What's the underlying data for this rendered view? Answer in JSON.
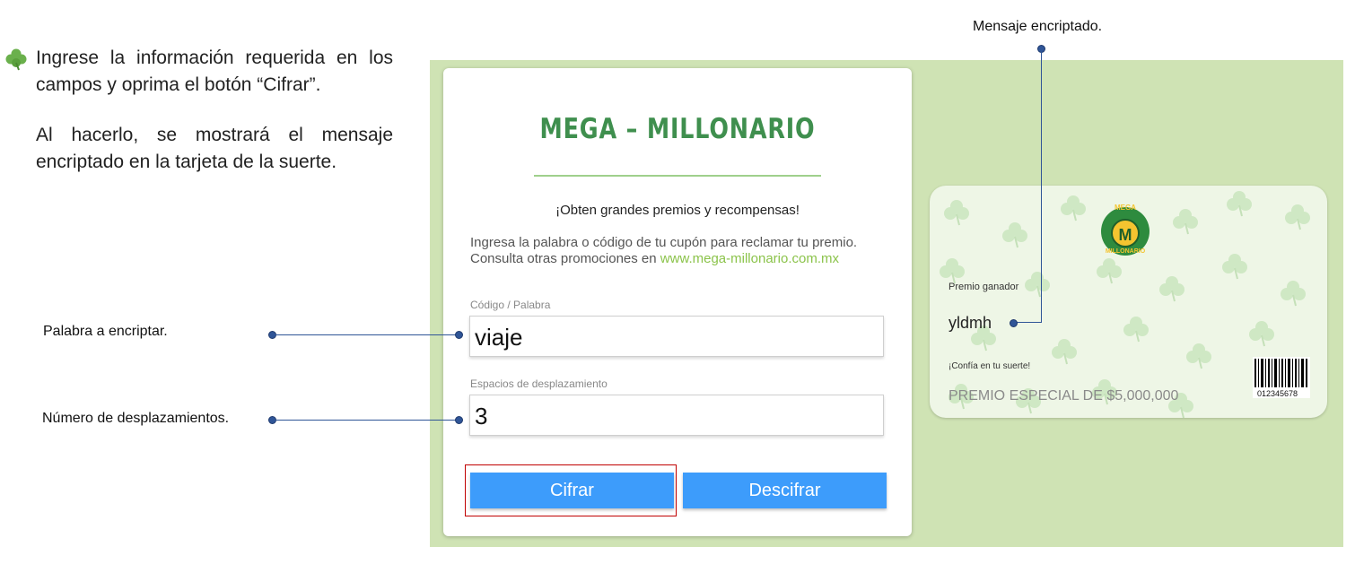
{
  "instructions": {
    "paragraph_1": "Ingrese la información requerida en los campos y oprima el botón “Cifrar”.",
    "paragraph_2": "Al hacerlo, se mostrará el mensaje encriptado en la tarjeta de la suerte."
  },
  "callouts": {
    "palabra": "Palabra a encriptar.",
    "desplazamientos": "Número de desplazamientos.",
    "mensaje": "Mensaje encriptado."
  },
  "form": {
    "brand": "MEGA – MILLONARIO",
    "tagline": "¡Obten grandes premios y recompensas!",
    "desc_line_1": "Ingresa la palabra o código de tu cupón para reclamar tu premio.",
    "desc_line_2_prefix": "Consulta otras promociones en ",
    "desc_link": "www.mega-millonario.com.mx",
    "code_label": "Código / Palabra",
    "code_value": "viaje",
    "shift_label": "Espacios de desplazamiento",
    "shift_value": "3",
    "encrypt_label": "Cifrar",
    "decrypt_label": "Descifrar"
  },
  "card": {
    "logo_text_top": "MEGA",
    "logo_text_bottom": "MILLONARIO",
    "logo_initial": "M",
    "prize_label": "Premio ganador",
    "prize_value": "yldmh",
    "luck_text": "¡Confía en tu suerte!",
    "special_prize": "PREMIO ESPECIAL DE $5,000,000",
    "barcode_number": "012345678"
  },
  "colors": {
    "accent_green": "#3f8f4e",
    "panel_green": "#cfe3b4",
    "button_blue": "#3d9cfb",
    "callout_blue": "#2f5597",
    "highlight_red": "#c00000"
  },
  "icons": {
    "bullet": "clover-icon",
    "card_background": "clover-pattern"
  }
}
